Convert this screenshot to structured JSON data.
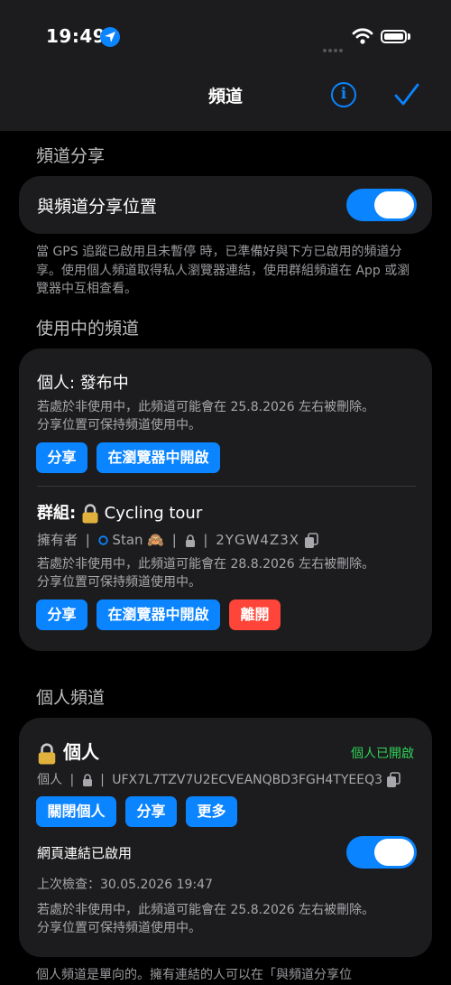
{
  "status_bar": {
    "time": "19:49"
  },
  "nav": {
    "title": "頻道"
  },
  "share_section": {
    "header": "頻道分享",
    "toggle_label": "與頻道分享位置",
    "toggle_on": true,
    "footer": "當 GPS 追蹤已啟用且未暫停 時，已準備好與下方已啟用的頻道分享。使用個人頻道取得私人瀏覽器連結，使用群組頻道在 App 或瀏覽器中互相查看。"
  },
  "active_section": {
    "header": "使用中的頻道",
    "personal": {
      "title": "個人: 發布中",
      "warning1": "若處於非使用中，此頻道可能會在 25.8.2026 左右被刪除。",
      "warning2": "分享位置可保持頻道使用中。",
      "share_label": "分享",
      "open_browser_label": "在瀏覽器中開啟"
    },
    "group": {
      "title_prefix": "群組:",
      "title_name": "Cycling tour",
      "owner_label": "擁有者",
      "sep": "|",
      "owner_name": "Stan",
      "owner_emoji": "🙈",
      "code": "2YGW4Z3X",
      "warning1": "若處於非使用中，此頻道可能會在 28.8.2026 左右被刪除。",
      "warning2": "分享位置可保持頻道使用中。",
      "share_label": "分享",
      "open_browser_label": "在瀏覽器中開啟",
      "leave_label": "離開"
    }
  },
  "personal_section": {
    "header": "個人頻道",
    "title": "個人",
    "status": "個人已開啟",
    "type_label": "個人",
    "sep": "|",
    "code": "UFX7L7TZV7U2ECVEANQBD3FGH4TYEEQ3",
    "close_label": "關閉個人",
    "share_label": "分享",
    "more_label": "更多",
    "weblink_label": "網頁連結已啟用",
    "weblink_on": true,
    "last_checked": "上次檢查：30.05.2026 19:47",
    "warning1": "若處於非使用中，此頻道可能會在 25.8.2026 左右被刪除。",
    "warning2": "分享位置可保持頻道使用中。",
    "footer": "個人頻道是單向的。擁有連結的人可以在「與頻道分享位"
  },
  "colors": {
    "accent": "#0a84ff",
    "danger": "#ff453a",
    "success": "#30d158",
    "card": "#1c1c1e"
  }
}
